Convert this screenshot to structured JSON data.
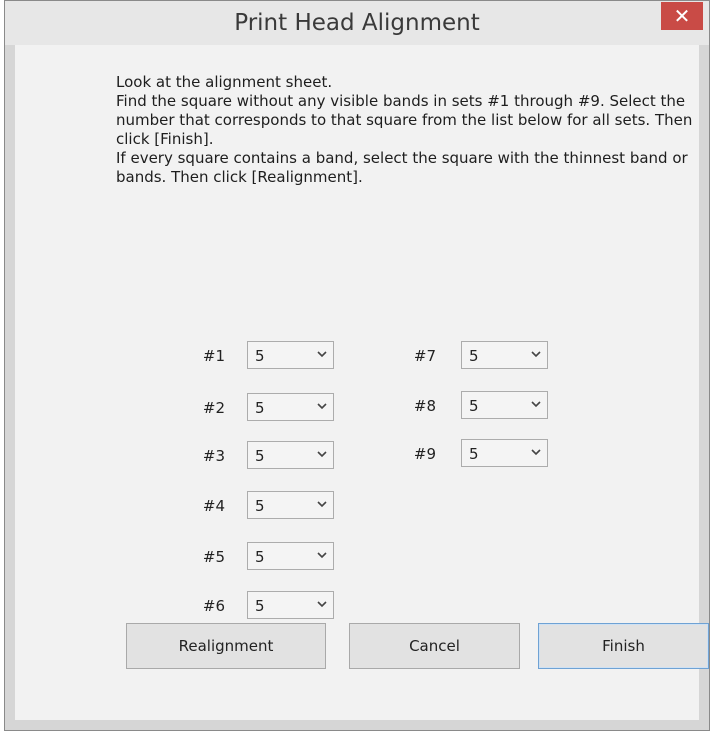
{
  "window": {
    "title": "Print Head Alignment",
    "close_label": "✕"
  },
  "instructions": [
    "Look at the alignment sheet.",
    "Find the square without any visible bands in sets #1 through #9. Select the number that corresponds to that square from the list below for all sets. Then click [Finish].",
    "If every square contains a band, select the square with the thinnest band or bands. Then click [Realignment]."
  ],
  "sets": [
    {
      "label": "#1",
      "value": "5"
    },
    {
      "label": "#2",
      "value": "5"
    },
    {
      "label": "#3",
      "value": "5"
    },
    {
      "label": "#4",
      "value": "5"
    },
    {
      "label": "#5",
      "value": "5"
    },
    {
      "label": "#6",
      "value": "5"
    },
    {
      "label": "#7",
      "value": "5"
    },
    {
      "label": "#8",
      "value": "5"
    },
    {
      "label": "#9",
      "value": "5"
    }
  ],
  "buttons": {
    "realignment": "Realignment",
    "cancel": "Cancel",
    "finish": "Finish"
  },
  "icons": {
    "close": "close-icon",
    "dropdown": "chevron-down-icon"
  },
  "colors": {
    "close_button": "#c94b46",
    "finish_border": "#6fa2d4"
  }
}
